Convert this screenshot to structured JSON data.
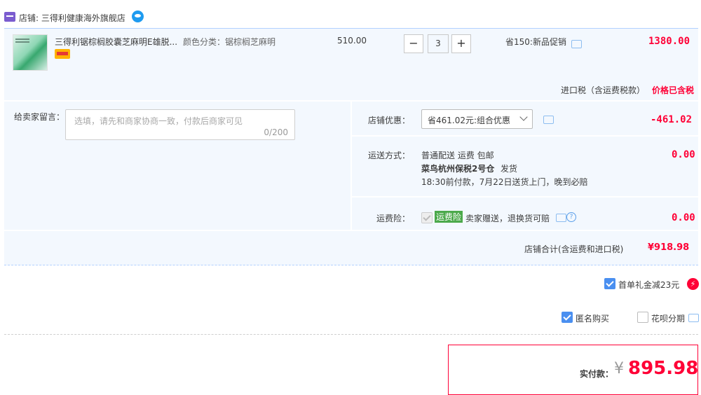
{
  "shop": {
    "name": "店铺: 三得利健康海外旗舰店"
  },
  "item": {
    "title": "三得利锯棕榈胶囊芝麻明E雄脱...",
    "sku_label": "颜色分类：锯棕榈芝麻明",
    "price": "510.00",
    "quantity": "3",
    "minus_label": "−",
    "plus_label": "+",
    "promo": "省150:新品促销",
    "total": "1380.00"
  },
  "tax": {
    "label": "进口税（含运费税款）",
    "value": "价格已含税"
  },
  "message": {
    "label": "给卖家留言：",
    "placeholder": "选填，请先和商家协商一致，付款后商家可见",
    "counter": "0/200"
  },
  "discount": {
    "label": "店铺优惠：",
    "selected": "省461.02元:组合优惠",
    "amount": "-461.02"
  },
  "shipping": {
    "label": "运送方式：",
    "line1": "普通配送 运费 包邮",
    "line2_warehouse": "菜鸟杭州保税2号仓",
    "line2_ship": "发货",
    "line3": "18:30前付款，7月22日送货上门，晚到必赔",
    "amount": "0.00"
  },
  "insurance": {
    "label": "运费险：",
    "tag": "运费险",
    "desc": "卖家赠送，退换货可赔",
    "amount": "0.00"
  },
  "shop_total": {
    "label": "店铺合计(含运费和进口税)",
    "value": "¥918.98"
  },
  "options": {
    "gift": {
      "label": "首单礼金减23元",
      "checked": true
    },
    "anonymous": {
      "label": "匿名购买",
      "checked": true
    },
    "huabei": {
      "label": "花呗分期",
      "checked": false
    }
  },
  "payment": {
    "label": "实付款：",
    "currency": "¥",
    "amount": "895.98"
  },
  "colors": {
    "accent_red": "#ff0036",
    "panel_bg": "#f3f8fe",
    "border_blue": "#b2d1ff"
  },
  "icons": [
    "shop-icon",
    "wangwang-icon",
    "message-bubble-icon",
    "chevron-down-icon",
    "help-icon",
    "lightning-icon"
  ]
}
